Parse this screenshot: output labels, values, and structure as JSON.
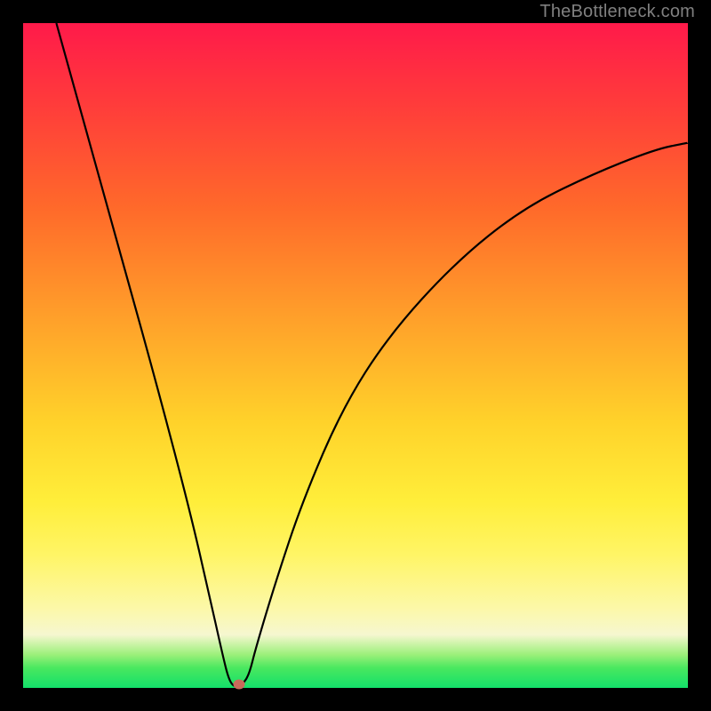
{
  "watermark": "TheBottleneck.com",
  "chart_data": {
    "type": "line",
    "title": "",
    "xlabel": "",
    "ylabel": "",
    "xlim": [
      0,
      100
    ],
    "ylim": [
      0,
      100
    ],
    "grid": false,
    "series": [
      {
        "name": "curve",
        "x": [
          5,
          10,
          15,
          20,
          25,
          28,
          30,
          31,
          32,
          33,
          34,
          35,
          38,
          42,
          48,
          55,
          65,
          75,
          85,
          95,
          100
        ],
        "y": [
          100,
          82,
          64,
          46,
          27,
          14,
          5,
          1,
          0,
          0.5,
          2,
          6,
          16,
          28,
          42,
          53,
          64,
          72,
          77,
          81,
          82
        ]
      }
    ],
    "marker": {
      "x": 32.5,
      "y": 0.5,
      "color": "#c96a5a"
    }
  },
  "colors": {
    "frame": "#000000",
    "gradient_top": "#ff1a4a",
    "gradient_mid1": "#ffa22a",
    "gradient_mid2": "#ffee3a",
    "gradient_bottom": "#13e06a",
    "curve": "#000000",
    "marker": "#c96a5a",
    "watermark": "#808080"
  }
}
